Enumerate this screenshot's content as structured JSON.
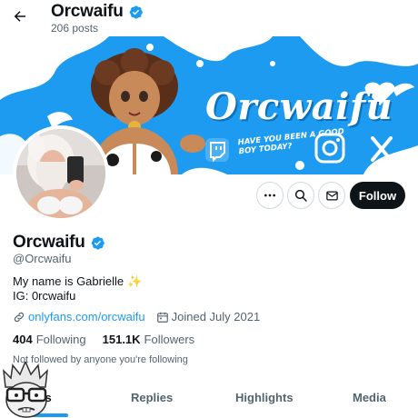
{
  "header": {
    "back_icon": "arrow-left-icon",
    "title": "Orcwaifu",
    "post_count": "206 posts",
    "verified_icon": "verified-badge-icon"
  },
  "banner": {
    "brand_text": "Orcwaifu",
    "tagline": "HAVE YOU BEEN A GOOD BOY TODAY?",
    "icons": [
      "twitch-icon",
      "instagram-icon",
      "x-logo-icon",
      "heart-wings-icon"
    ],
    "background_color": "#1d9bf0"
  },
  "actions": {
    "more_icon": "more-dots-icon",
    "search_icon": "search-icon",
    "message_icon": "envelope-icon",
    "follow_label": "Follow"
  },
  "profile": {
    "display_name": "Orcwaifu",
    "handle": "@Orcwaifu",
    "bio_line1": "My name is Gabrielle",
    "bio_emoji": "✨",
    "bio_line2": "IG: 0rcwaifu",
    "link_text": "onlyfans.com/orcwaifu",
    "link_icon": "link-icon",
    "joined_icon": "calendar-icon",
    "joined_text": "Joined July 2021",
    "following_count": "404",
    "following_label": "Following",
    "followers_count": "151.1K",
    "followers_label": "Followers",
    "not_followed_text": "Not followed by anyone you're following"
  },
  "tabs": [
    {
      "label": "Posts",
      "visible_label": "sts",
      "active": true
    },
    {
      "label": "Replies",
      "active": false
    },
    {
      "label": "Highlights",
      "active": false
    },
    {
      "label": "Media",
      "active": false
    }
  ],
  "colors": {
    "accent": "#1d9bf0",
    "text_primary": "#0f1419",
    "text_secondary": "#536471",
    "follow_button_bg": "#0f1419"
  }
}
